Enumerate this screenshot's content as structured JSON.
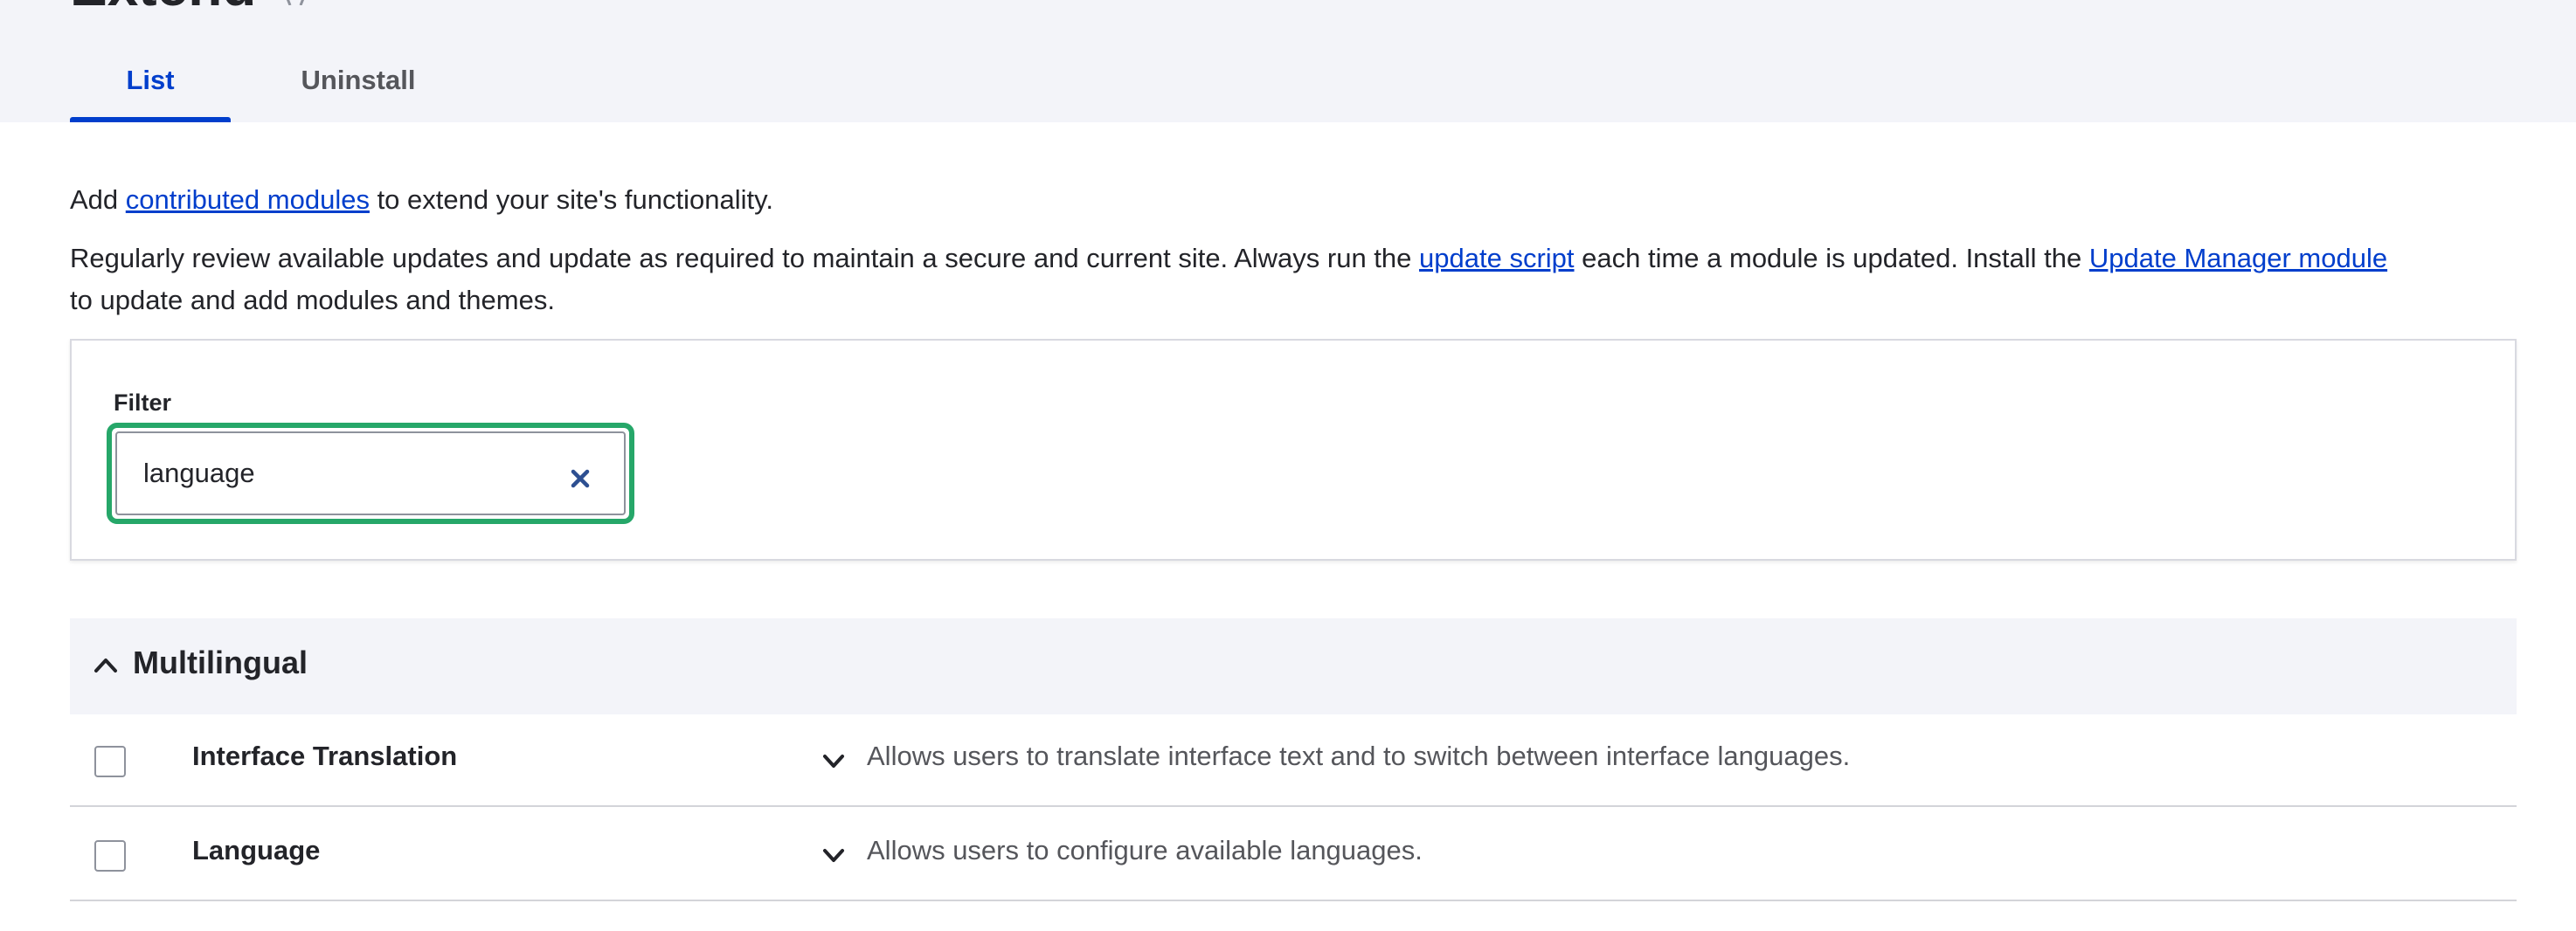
{
  "header": {
    "page_title": "Extend",
    "tabs": [
      {
        "label": "List",
        "active": true
      },
      {
        "label": "Uninstall",
        "active": false
      }
    ]
  },
  "intro": {
    "line1_before": "Add ",
    "line1_link": "contributed modules",
    "line1_after": " to extend your site's functionality.",
    "line2_before": "Regularly review available updates and update as required to maintain a secure and current site. Always run the ",
    "line2_link1": "update script",
    "line2_middle": " each time a module is updated. Install the ",
    "line2_link2": "Update Manager module",
    "line3": "to update and add modules and themes."
  },
  "filter": {
    "label": "Filter",
    "value": "language"
  },
  "group": {
    "title": "Multilingual",
    "modules": [
      {
        "name": "Interface Translation",
        "description": "Allows users to translate interface text and to switch between interface languages.",
        "checked": false
      },
      {
        "name": "Language",
        "description": "Allows users to configure available languages.",
        "checked": false
      }
    ]
  },
  "colors": {
    "accent": "#003ecc",
    "focus": "#26a769",
    "header_bg": "#f3f4f9"
  }
}
